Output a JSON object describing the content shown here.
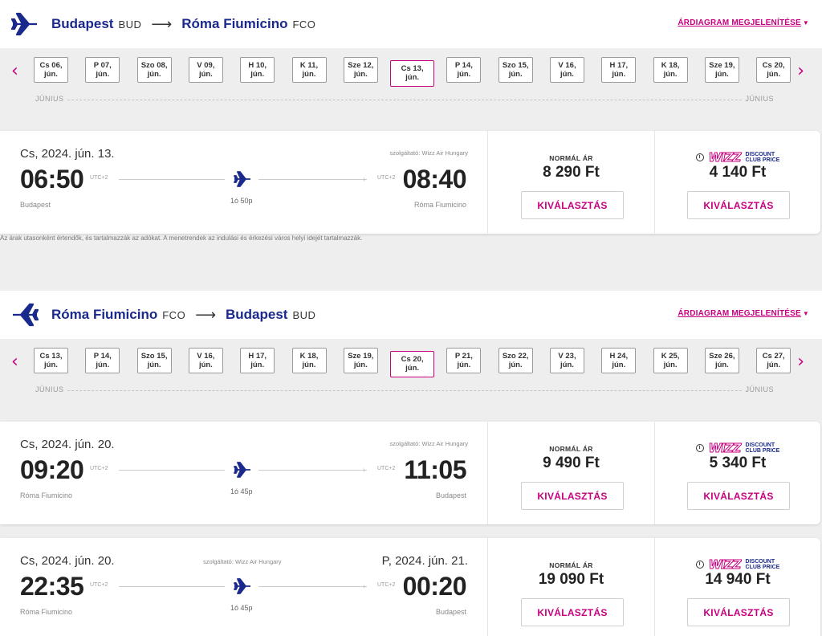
{
  "outbound": {
    "from_city": "Budapest",
    "from_code": "BUD",
    "to_city": "Róma Fiumicino",
    "to_code": "FCO",
    "arrow": "⟶",
    "price_chart_label": "ÁRDIAGRAM MEGJELENÍTÉSE",
    "dates": [
      {
        "line1": "Cs 06,",
        "line2": "jún."
      },
      {
        "line1": "P 07,",
        "line2": "jún."
      },
      {
        "line1": "Szo 08,",
        "line2": "jún."
      },
      {
        "line1": "V 09,",
        "line2": "jún."
      },
      {
        "line1": "H 10,",
        "line2": "jún."
      },
      {
        "line1": "K 11,",
        "line2": "jún."
      },
      {
        "line1": "Sze 12,",
        "line2": "jún."
      },
      {
        "line1": "Cs 13,",
        "line2": "jún.",
        "selected": true
      },
      {
        "line1": "P 14,",
        "line2": "jún."
      },
      {
        "line1": "Szo 15,",
        "line2": "jún."
      },
      {
        "line1": "V 16,",
        "line2": "jún."
      },
      {
        "line1": "H 17,",
        "line2": "jún."
      },
      {
        "line1": "K 18,",
        "line2": "jún."
      },
      {
        "line1": "Sze 19,",
        "line2": "jún."
      },
      {
        "line1": "Cs 20,",
        "line2": "jún."
      }
    ],
    "month_left": "JÚNIUS",
    "month_right": "JÚNIUS",
    "flights": [
      {
        "dep_date": "Cs, 2024. jún. 13.",
        "arr_date": "",
        "operator": "szolgáltató: Wizz Air Hungary",
        "dep_time": "06:50",
        "dep_tz": "UTC+2",
        "arr_time": "08:40",
        "arr_tz": "UTC+2",
        "duration": "1ó 50p",
        "dep_city": "Budapest",
        "arr_city": "Róma Fiumicino",
        "normal_label": "NORMÁL ÁR",
        "normal_price": "8 290 Ft",
        "club_logo": "WIZZ",
        "club_line1": "DISCOUNT",
        "club_line2": "CLUB PRICE",
        "club_price": "4 140 Ft",
        "select_label": "KIVÁLASZTÁS"
      }
    ]
  },
  "disclaimer": "Az árak utasonként értendők, és tartalmazzák az adókat. A menetrendek az indulási és érkezési város helyi idejét tartalmazzák.",
  "inbound": {
    "from_city": "Róma Fiumicino",
    "from_code": "FCO",
    "to_city": "Budapest",
    "to_code": "BUD",
    "arrow": "⟶",
    "price_chart_label": "ÁRDIAGRAM MEGJELENÍTÉSE",
    "dates": [
      {
        "line1": "Cs 13,",
        "line2": "jún."
      },
      {
        "line1": "P 14,",
        "line2": "jún."
      },
      {
        "line1": "Szo 15,",
        "line2": "jún."
      },
      {
        "line1": "V 16,",
        "line2": "jún."
      },
      {
        "line1": "H 17,",
        "line2": "jún."
      },
      {
        "line1": "K 18,",
        "line2": "jún."
      },
      {
        "line1": "Sze 19,",
        "line2": "jún."
      },
      {
        "line1": "Cs 20,",
        "line2": "jún.",
        "selected": true
      },
      {
        "line1": "P 21,",
        "line2": "jún."
      },
      {
        "line1": "Szo 22,",
        "line2": "jún."
      },
      {
        "line1": "V 23,",
        "line2": "jún."
      },
      {
        "line1": "H 24,",
        "line2": "jún."
      },
      {
        "line1": "K 25,",
        "line2": "jún."
      },
      {
        "line1": "Sze 26,",
        "line2": "jún."
      },
      {
        "line1": "Cs 27,",
        "line2": "jún."
      }
    ],
    "month_left": "JÚNIUS",
    "month_right": "JÚNIUS",
    "flights": [
      {
        "dep_date": "Cs, 2024. jún. 20.",
        "arr_date": "",
        "operator": "szolgáltató: Wizz Air Hungary",
        "dep_time": "09:20",
        "dep_tz": "UTC+2",
        "arr_time": "11:05",
        "arr_tz": "UTC+2",
        "duration": "1ó 45p",
        "dep_city": "Róma Fiumicino",
        "arr_city": "Budapest",
        "normal_label": "NORMÁL ÁR",
        "normal_price": "9 490 Ft",
        "club_logo": "WIZZ",
        "club_line1": "DISCOUNT",
        "club_line2": "CLUB PRICE",
        "club_price": "5 340 Ft",
        "select_label": "KIVÁLASZTÁS"
      },
      {
        "dep_date": "Cs, 2024. jún. 20.",
        "arr_date": "P, 2024. jún. 21.",
        "operator": "szolgáltató: Wizz Air Hungary",
        "dep_time": "22:35",
        "dep_tz": "UTC+2",
        "arr_time": "00:20",
        "arr_tz": "UTC+2",
        "duration": "1ó 45p",
        "dep_city": "Róma Fiumicino",
        "arr_city": "Budapest",
        "normal_label": "NORMÁL ÁR",
        "normal_price": "19 090 Ft",
        "club_logo": "WIZZ",
        "club_line1": "DISCOUNT",
        "club_line2": "CLUB PRICE",
        "club_price": "14 940 Ft",
        "select_label": "KIVÁLASZTÁS"
      }
    ]
  },
  "colors": {
    "brand_navy": "#1a2a8c",
    "brand_magenta": "#c6007e"
  },
  "icons": {
    "plane": "plane-icon",
    "prev": "chevron-left-icon",
    "next": "chevron-right-icon",
    "info": "info-icon"
  }
}
